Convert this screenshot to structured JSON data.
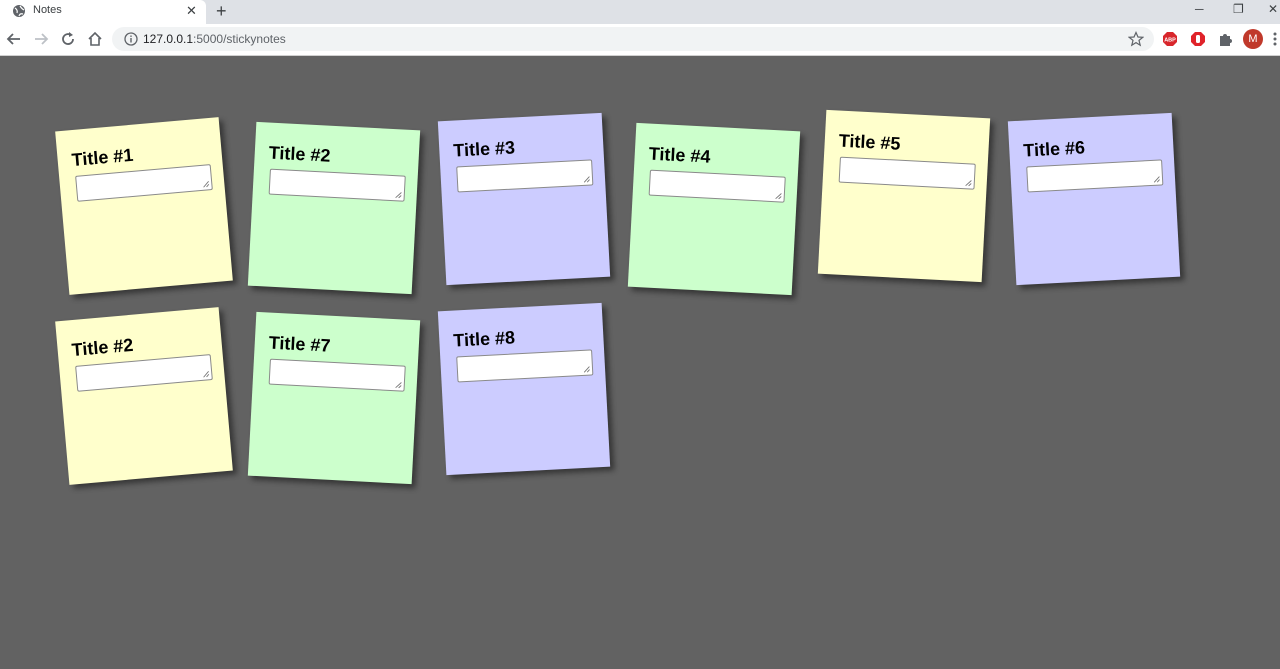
{
  "browser": {
    "tab_title": "Notes",
    "tab_close": "✕",
    "new_tab": "+",
    "url_host": "127.0.0.1",
    "url_rest": ":5000/stickynotes",
    "window_controls": {
      "minimize": "─",
      "restore": "❐",
      "close": "✕"
    },
    "avatar_letter": "M",
    "extensions": [
      "adblock-plus-icon",
      "adblock-hand-icon",
      "puzzle-extensions-icon"
    ]
  },
  "notes": [
    {
      "title": "Title #1",
      "value": "",
      "color": "#ffffcc"
    },
    {
      "title": "Title #2",
      "value": "",
      "color": "#ccffcc"
    },
    {
      "title": "Title #3",
      "value": "",
      "color": "#ccccff"
    },
    {
      "title": "Title #4",
      "value": "",
      "color": "#ccffcc"
    },
    {
      "title": "Title #5",
      "value": "",
      "color": "#ffffcc"
    },
    {
      "title": "Title #6",
      "value": "",
      "color": "#ccccff"
    },
    {
      "title": "Title #2",
      "value": "",
      "color": "#ffffcc"
    },
    {
      "title": "Title #7",
      "value": "",
      "color": "#ccffcc"
    },
    {
      "title": "Title #8",
      "value": "",
      "color": "#ccccff"
    }
  ],
  "colors": {
    "board_background": "#626262",
    "tabstrip": "#dee1e6"
  }
}
